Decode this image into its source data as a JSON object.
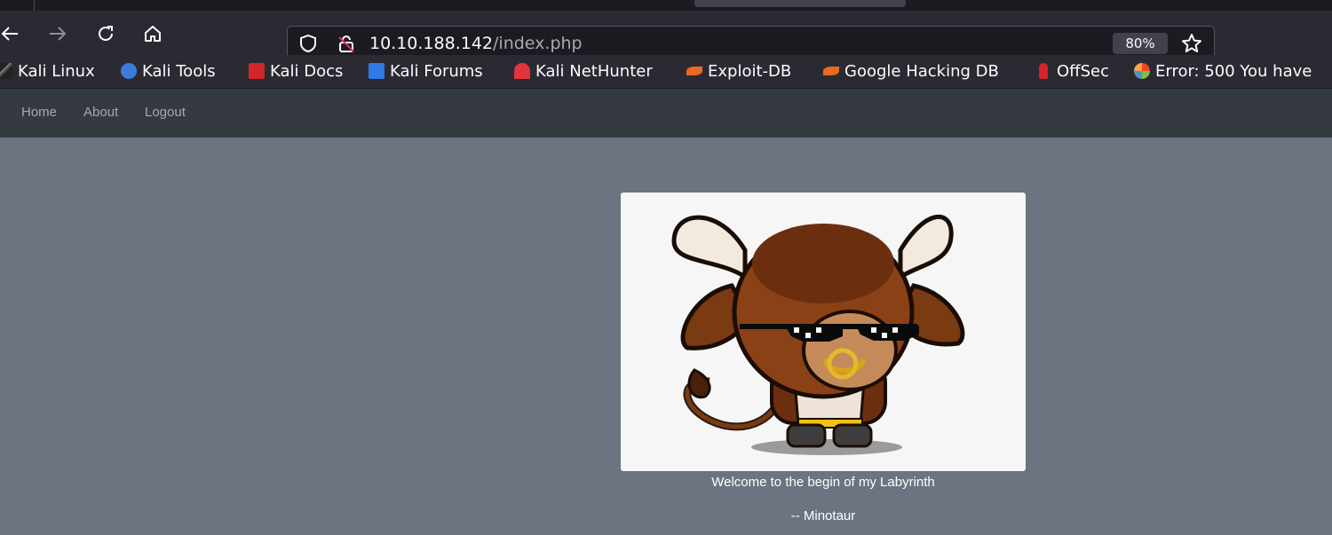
{
  "browser": {
    "url_host": "10.10.188.142",
    "url_path": "/index.php",
    "zoom": "80%"
  },
  "bookmarks": [
    {
      "label": "Kali Linux",
      "icon": "kali-dragon-icon"
    },
    {
      "label": "Kali Tools",
      "icon": "kali-tools-icon"
    },
    {
      "label": "Kali Docs",
      "icon": "kali-docs-icon"
    },
    {
      "label": "Kali Forums",
      "icon": "kali-forums-icon"
    },
    {
      "label": "Kali NetHunter",
      "icon": "nethunter-icon"
    },
    {
      "label": "Exploit-DB",
      "icon": "exploit-db-icon"
    },
    {
      "label": "Google Hacking DB",
      "icon": "ghdb-icon"
    },
    {
      "label": "OffSec",
      "icon": "offsec-icon"
    },
    {
      "label": "Error: 500 You have",
      "icon": "joomla-icon"
    }
  ],
  "site": {
    "nav": [
      "Home",
      "About",
      "Logout"
    ],
    "welcome": "Welcome to the begin of my Labyrinth",
    "signature": "-- Minotaur"
  },
  "colors": {
    "page_bg": "#6b7480",
    "site_nav_bg": "#353a40",
    "browser_bg": "#2b2a33"
  }
}
